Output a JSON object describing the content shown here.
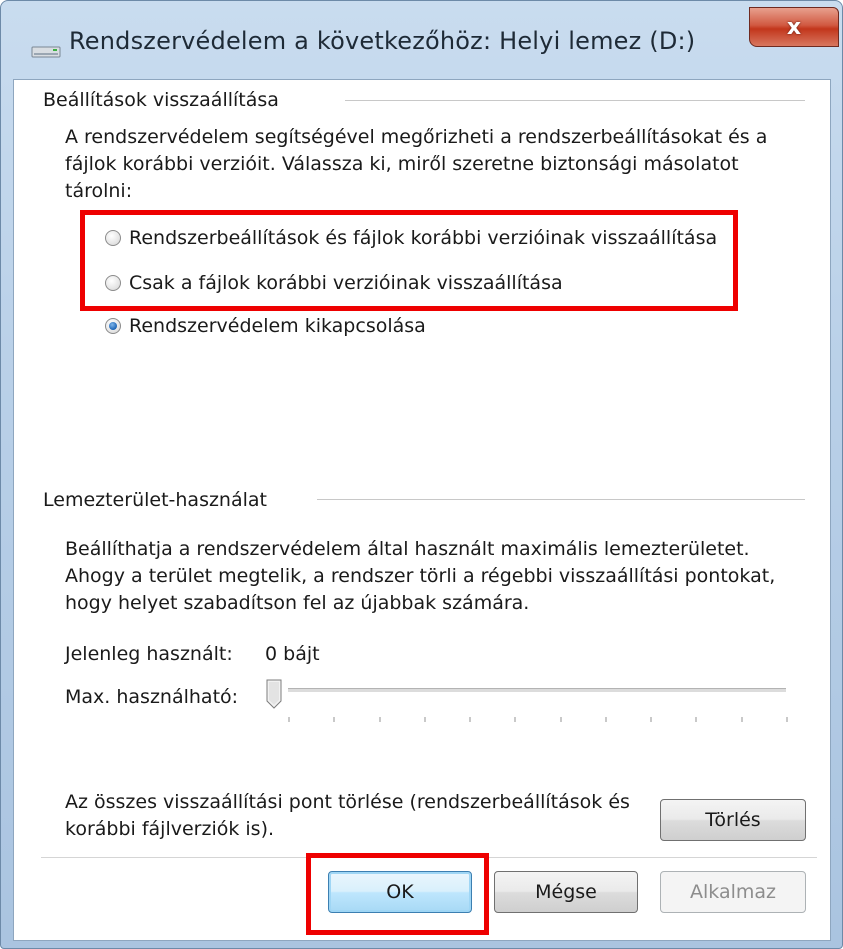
{
  "window": {
    "title": "Rendszervédelem a következőhöz: Helyi lemez (D:)",
    "close_label": "x"
  },
  "restore_settings": {
    "heading": "Beállítások visszaállítása",
    "description": "A rendszervédelem segítségével megőrizheti a rendszerbeállításokat és a fájlok korábbi verzióit. Válassza ki, miről szeretne biztonsági másolatot tárolni:",
    "options": [
      {
        "label": "Rendszerbeállítások és fájlok korábbi verzióinak visszaállítása",
        "checked": false
      },
      {
        "label": "Csak a fájlok korábbi verzióinak visszaállítása",
        "checked": false
      },
      {
        "label": "Rendszervédelem kikapcsolása",
        "checked": true
      }
    ]
  },
  "disk_usage": {
    "heading": "Lemezterület-használat",
    "description": "Beállíthatja a rendszervédelem által használt maximális lemezterületet. Ahogy a terület megtelik, a rendszer törli a régebbi visszaállítási pontokat, hogy helyet szabadítson fel az újabbak számára.",
    "current_label": "Jelenleg használt:",
    "current_value": "0 bájt",
    "max_label": "Max. használható:",
    "slider_value": 0
  },
  "delete_section": {
    "text": "Az összes visszaállítási pont törlése (rendszerbeállítások és korábbi fájlverziók is).",
    "button": "Törlés"
  },
  "buttons": {
    "ok": "OK",
    "cancel": "Mégse",
    "apply": "Alkalmaz"
  },
  "colors": {
    "highlight": "#ee0000",
    "radio_checked": "#1b63b5"
  }
}
